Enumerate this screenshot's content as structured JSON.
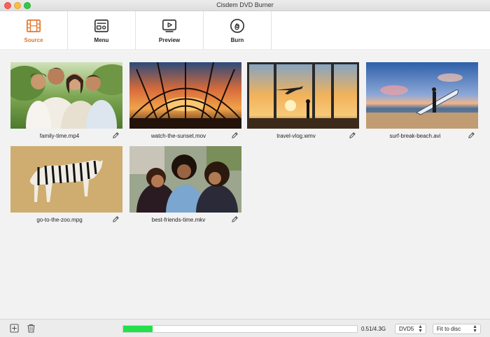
{
  "window": {
    "title": "Cisdem DVD Burner"
  },
  "toolbar": [
    {
      "label": "Source",
      "icon": "film-icon",
      "active": true
    },
    {
      "label": "Menu",
      "icon": "menu-icon",
      "active": false
    },
    {
      "label": "Preview",
      "icon": "play-icon",
      "active": false
    },
    {
      "label": "Burn",
      "icon": "disc-icon",
      "active": false
    }
  ],
  "videos": [
    {
      "name": "family-time.mp4"
    },
    {
      "name": "watch-the-sunset.mov"
    },
    {
      "name": "travel-vlog.wmv"
    },
    {
      "name": "surf-break-beach.avi"
    },
    {
      "name": "go-to-the-zoo.mpg"
    },
    {
      "name": "best-friends-time.mkv"
    }
  ],
  "bottom": {
    "size_text": "0.51/4.3G",
    "progress": 0.125,
    "disc_type": "DVD5",
    "fit_mode": "Fit to disc"
  },
  "colors": {
    "accent": "#e0762a",
    "progress": "#22e04a"
  }
}
